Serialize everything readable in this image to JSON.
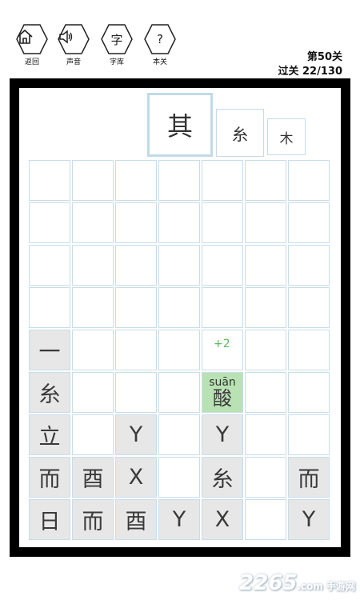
{
  "toolbar": {
    "back": {
      "glyph": "⌂",
      "label": "返回",
      "icon": "home-icon"
    },
    "sound": {
      "glyph": "🔊",
      "label": "声音",
      "icon": "speaker-icon"
    },
    "library": {
      "glyph": "字",
      "label": "字库"
    },
    "help": {
      "glyph": "?",
      "label": "本关"
    }
  },
  "level": {
    "title": "第50关",
    "progress": "过关 22/130"
  },
  "target": {
    "main": "其",
    "comp1": "糸",
    "comp2": "木"
  },
  "board": {
    "bonus": "+2",
    "highlight": {
      "pinyin": "suān",
      "char": "酸"
    },
    "cells": [
      "一",
      "糸",
      "立",
      "Y",
      "Y",
      "而",
      "酉",
      "X",
      "糸",
      "而",
      "日",
      "而",
      "酉",
      "Y",
      "X",
      "Y"
    ]
  },
  "watermark": {
    "brand": "2265",
    "sub": ".com 手游网"
  },
  "colors": {
    "frame": "#000000",
    "cell_border": "#c8dde8",
    "shade": "#e7e7e7",
    "highlight": "#b9e2b4",
    "bonus": "#5cb85c"
  }
}
